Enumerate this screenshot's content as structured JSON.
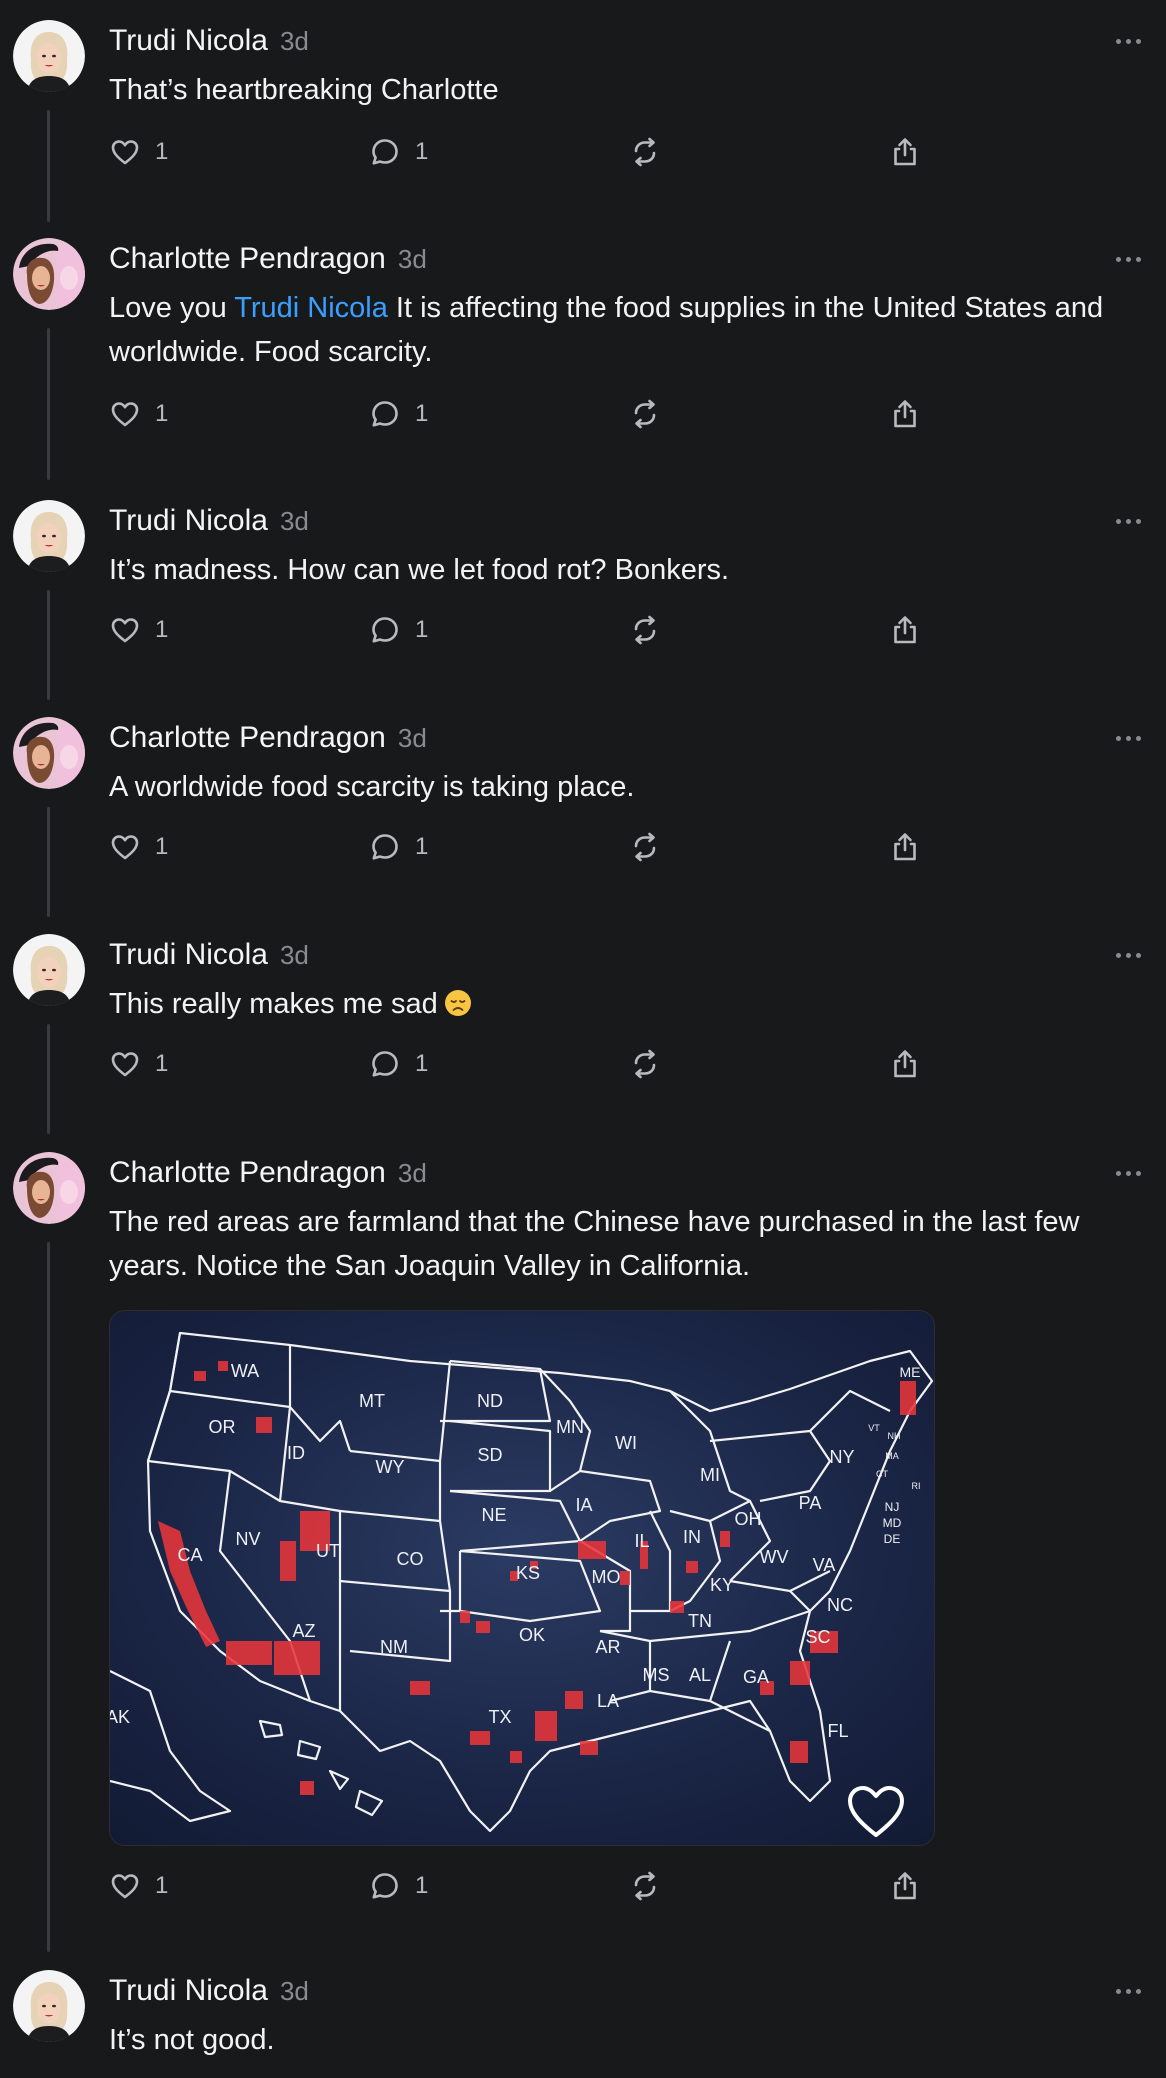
{
  "posts": [
    {
      "author": "Trudi Nicola",
      "time": "3d",
      "text": "That’s heartbreaking Charlotte",
      "likes": "1",
      "replies": "1"
    },
    {
      "author": "Charlotte Pendragon",
      "time": "3d",
      "text_before": "Love you ",
      "mention": "Trudi Nicola",
      "text_after": " It is affecting the food supplies in the United States and worldwide. Food scarcity.",
      "likes": "1",
      "replies": "1"
    },
    {
      "author": "Trudi Nicola",
      "time": "3d",
      "text": "It’s madness. How can we let food rot? Bonkers.",
      "likes": "1",
      "replies": "1"
    },
    {
      "author": "Charlotte Pendragon",
      "time": "3d",
      "text": "A worldwide food scarcity is taking place.",
      "likes": "1",
      "replies": "1"
    },
    {
      "author": "Trudi Nicola",
      "time": "3d",
      "text": "This really makes me sad",
      "emoji": "disappointed-face-emoji",
      "likes": "1",
      "replies": "1"
    },
    {
      "author": "Charlotte Pendragon",
      "time": "3d",
      "text": "The red areas are farmland that the Chinese have purchased in the last few years. Notice the San Joaquin Valley in California.",
      "likes": "1",
      "replies": "1",
      "image": {
        "type": "us-map",
        "state_labels": [
          "WA",
          "OR",
          "ID",
          "MT",
          "WY",
          "ND",
          "SD",
          "NE",
          "MN",
          "WI",
          "MI",
          "IA",
          "IL",
          "IN",
          "OH",
          "PA",
          "NY",
          "CA",
          "NV",
          "UT",
          "CO",
          "AZ",
          "NM",
          "KS",
          "MO",
          "OK",
          "AR",
          "TX",
          "LA",
          "MS",
          "AL",
          "GA",
          "TN",
          "KY",
          "WV",
          "VA",
          "NC",
          "SC",
          "FL",
          "AK",
          "ME",
          "NJ",
          "MD",
          "DE",
          "VT",
          "NH",
          "MA",
          "CT",
          "RI"
        ]
      }
    },
    {
      "author": "Trudi Nicola",
      "time": "3d",
      "text": "It’s not good."
    }
  ],
  "colors": {
    "background": "#18191b",
    "mention": "#3aa0ff",
    "muted": "#8a8b8f",
    "map_highlight": "#e8353a"
  }
}
